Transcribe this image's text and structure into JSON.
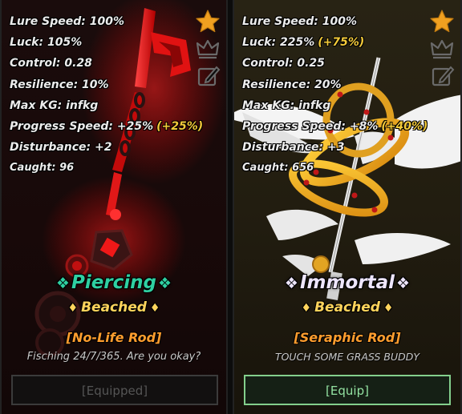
{
  "cards": [
    {
      "stats": {
        "lure_speed": "Lure Speed: 100%",
        "luck": "Luck: 105%",
        "control": "Control: 0.28",
        "resilience": "Resilience: 10%",
        "max_kg": "Max KG: infkg",
        "progress_speed": "Progress Speed: +25%",
        "progress_speed_bonus": "(+25%)",
        "disturbance": "Disturbance: +2",
        "caught": "Caught: 96"
      },
      "mutation": "Piercing",
      "mutation_deco": "❖",
      "modifier": "Beached",
      "modifier_deco": "♦",
      "rod_name": "[No-Life Rod]",
      "description": "Fisching 24/7/365. Are you okay?",
      "button_label": "[Equipped]",
      "favorite_active": true
    },
    {
      "stats": {
        "lure_speed": "Lure Speed: 100%",
        "luck": "Luck: 225%",
        "luck_bonus": "(+75%)",
        "control": "Control: 0.25",
        "resilience": "Resilience: 20%",
        "max_kg": "Max KG: infkg",
        "progress_speed": "Progress Speed: +8%",
        "progress_speed_bonus": "(+40%)",
        "disturbance": "Disturbance: +3",
        "caught": "Caught: 656"
      },
      "mutation": "Immortal",
      "mutation_deco": "❖",
      "modifier": "Beached",
      "modifier_deco": "♦",
      "rod_name": "[Seraphic Rod]",
      "description": "TOUCH SOME GRASS BUDDY",
      "button_label": "[Equip]",
      "favorite_active": true
    }
  ],
  "icons": [
    "star-icon",
    "crown-icon",
    "edit-icon"
  ],
  "colors": {
    "bonus": "#f4cb3a",
    "piercing": "#2fd0a2",
    "immortal": "#eee6ff",
    "modifier": "#ffd45c",
    "rod_name": "#ff9d2e",
    "equip_border": "#83cf8c",
    "favorite_star": "#f0a020"
  }
}
